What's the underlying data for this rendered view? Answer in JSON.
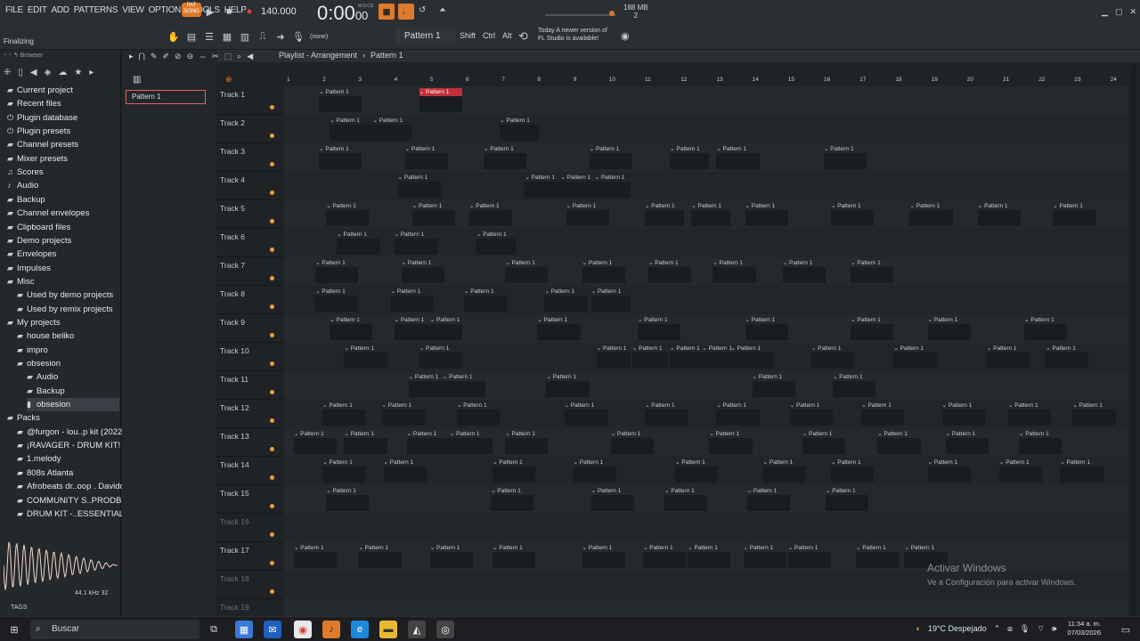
{
  "menu": [
    "FILE",
    "EDIT",
    "ADD",
    "PATTERNS",
    "VIEW",
    "OPTIONS",
    "TOOLS",
    "HELP"
  ],
  "transport": {
    "mode": "PAT SONG",
    "bpm": "140.000",
    "time_main": "0:00",
    "time_sub": "00",
    "time_unit": "M:S:CS"
  },
  "status": "Finalizing",
  "memory": {
    "label": "188 MB",
    "value": "2"
  },
  "toolbar": {
    "channel": "(none)",
    "pattern": "Pattern 1",
    "shift": "Shift",
    "ctrl": "Ctrl",
    "alt": "Alt"
  },
  "news": {
    "line1": "Today  A newer version of",
    "line2": "FL Studio is available!"
  },
  "browser": {
    "title": "Browser",
    "items": [
      {
        "label": "Current project",
        "icon": "folder-icon",
        "indent": 0
      },
      {
        "label": "Recent files",
        "icon": "folder-icon",
        "indent": 0
      },
      {
        "label": "Plugin database",
        "icon": "plug-icon",
        "indent": 0
      },
      {
        "label": "Plugin presets",
        "icon": "plug-icon",
        "indent": 0
      },
      {
        "label": "Channel presets",
        "icon": "folder-icon",
        "indent": 0
      },
      {
        "label": "Mixer presets",
        "icon": "folder-icon",
        "indent": 0
      },
      {
        "label": "Scores",
        "icon": "note-icon",
        "indent": 0
      },
      {
        "label": "Audio",
        "icon": "audio-icon",
        "indent": 0
      },
      {
        "label": "Backup",
        "icon": "folder-icon",
        "indent": 0
      },
      {
        "label": "Channel envelopes",
        "icon": "folder-icon",
        "indent": 0
      },
      {
        "label": "Clipboard files",
        "icon": "folder-icon",
        "indent": 0
      },
      {
        "label": "Demo projects",
        "icon": "folder-icon",
        "indent": 0
      },
      {
        "label": "Envelopes",
        "icon": "folder-icon",
        "indent": 0
      },
      {
        "label": "Impulses",
        "icon": "folder-icon",
        "indent": 0
      },
      {
        "label": "Misc",
        "icon": "folder-icon",
        "indent": 0
      },
      {
        "label": "Used by demo projects",
        "icon": "folder-icon",
        "indent": 1
      },
      {
        "label": "Used by remix projects",
        "icon": "folder-icon",
        "indent": 1
      },
      {
        "label": "My projects",
        "icon": "folder-icon",
        "indent": 0
      },
      {
        "label": "house beliko",
        "icon": "folder-icon",
        "indent": 1
      },
      {
        "label": "impro",
        "icon": "folder-icon",
        "indent": 1
      },
      {
        "label": "obsesion",
        "icon": "folder-icon",
        "indent": 1
      },
      {
        "label": "Audio",
        "icon": "folder-icon",
        "indent": 2
      },
      {
        "label": "Backup",
        "icon": "folder-icon",
        "indent": 2
      },
      {
        "label": "obsesion",
        "icon": "file-icon",
        "indent": 2,
        "selected": true
      },
      {
        "label": "Packs",
        "icon": "folder-icon",
        "indent": 0
      },
      {
        "label": "@furgon - lou..p kit (2022)",
        "icon": "pack-icon",
        "indent": 1
      },
      {
        "label": "¡RAVAGER - DRUM KIT!",
        "icon": "pack-icon",
        "indent": 1
      },
      {
        "label": "1.melody",
        "icon": "pack-icon",
        "indent": 1
      },
      {
        "label": "808s Atlanta",
        "icon": "pack-icon",
        "indent": 1
      },
      {
        "label": "Afrobeats dr..oop . Davido",
        "icon": "pack-icon",
        "indent": 1
      },
      {
        "label": "COMMUNITY S..PRODBYLJS",
        "icon": "pack-icon",
        "indent": 1
      },
      {
        "label": "DRUM KIT -..ESSENTIALS",
        "icon": "pack-icon",
        "indent": 1
      }
    ],
    "samplerate": "44.1 kHz 32",
    "tags": "TAGS"
  },
  "picker": {
    "pattern": "Pattern 1"
  },
  "playlist": {
    "title": "Playlist - Arrangement",
    "pattern": "Pattern 1",
    "ruler": [
      "1",
      "2",
      "3",
      "4",
      "5",
      "6",
      "7",
      "8",
      "9",
      "10",
      "11",
      "12",
      "13",
      "14",
      "15",
      "16",
      "17",
      "18",
      "19",
      "20",
      "21",
      "22",
      "23",
      "24"
    ],
    "clip_label": "Pattern 1",
    "tracks": [
      {
        "name": "Track 1",
        "clips": [
          [
            1.9,
            1.2
          ],
          [
            4.7,
            1.2,
            "red"
          ]
        ]
      },
      {
        "name": "Track 2",
        "clips": [
          [
            2.2,
            1.2
          ],
          [
            3.4,
            1.1
          ],
          [
            6.95,
            1.1
          ]
        ]
      },
      {
        "name": "Track 3",
        "clips": [
          [
            1.9,
            1.2
          ],
          [
            4.3,
            1.2
          ],
          [
            6.5,
            1.2
          ],
          [
            9.45,
            1.2
          ],
          [
            11.7,
            1.1
          ],
          [
            13.0,
            1.2
          ],
          [
            16.0,
            1.2
          ]
        ]
      },
      {
        "name": "Track 4",
        "clips": [
          [
            4.1,
            1.2
          ],
          [
            7.65,
            1.0
          ],
          [
            8.65,
            0.95
          ],
          [
            9.6,
            1.0
          ]
        ]
      },
      {
        "name": "Track 5",
        "clips": [
          [
            2.1,
            1.2
          ],
          [
            4.5,
            1.2
          ],
          [
            6.1,
            1.2
          ],
          [
            8.8,
            1.2
          ],
          [
            11.0,
            1.1
          ],
          [
            12.3,
            1.1
          ],
          [
            13.8,
            1.2
          ],
          [
            16.2,
            1.2
          ],
          [
            18.4,
            1.2
          ],
          [
            20.3,
            1.2
          ],
          [
            22.4,
            1.2
          ]
        ]
      },
      {
        "name": "Track 6",
        "clips": [
          [
            2.4,
            1.2
          ],
          [
            4.0,
            1.2
          ],
          [
            6.3,
            1.1
          ]
        ]
      },
      {
        "name": "Track 7",
        "clips": [
          [
            1.8,
            1.2
          ],
          [
            4.2,
            1.2
          ],
          [
            7.1,
            1.2
          ],
          [
            9.25,
            1.2
          ],
          [
            11.1,
            1.2
          ],
          [
            12.9,
            1.2
          ],
          [
            14.85,
            1.2
          ],
          [
            16.75,
            1.2
          ]
        ]
      },
      {
        "name": "Track 8",
        "clips": [
          [
            1.8,
            1.2
          ],
          [
            3.9,
            1.2
          ],
          [
            5.95,
            1.2
          ],
          [
            8.2,
            1.2
          ],
          [
            9.5,
            1.1
          ]
        ]
      },
      {
        "name": "Track 9",
        "clips": [
          [
            2.2,
            1.2
          ],
          [
            4.0,
            1.2
          ],
          [
            5.0,
            0.9
          ],
          [
            8.0,
            1.2
          ],
          [
            10.8,
            1.2
          ],
          [
            13.8,
            1.2
          ],
          [
            16.75,
            1.2
          ],
          [
            18.9,
            1.2
          ],
          [
            21.6,
            1.2
          ]
        ]
      },
      {
        "name": "Track 10",
        "clips": [
          [
            2.6,
            1.2
          ],
          [
            4.7,
            1.2
          ],
          [
            9.65,
            0.95
          ],
          [
            10.65,
            1.0
          ],
          [
            11.7,
            0.9
          ],
          [
            12.6,
            0.9
          ],
          [
            13.4,
            1.2
          ],
          [
            15.65,
            1.2
          ],
          [
            17.95,
            1.2
          ],
          [
            20.55,
            1.2
          ],
          [
            22.2,
            1.2
          ]
        ]
      },
      {
        "name": "Track 11",
        "clips": [
          [
            4.4,
            1.0
          ],
          [
            5.35,
            1.2
          ],
          [
            8.25,
            1.2
          ],
          [
            14.0,
            1.2
          ],
          [
            16.25,
            1.2
          ]
        ]
      },
      {
        "name": "Track 12",
        "clips": [
          [
            2.0,
            1.2
          ],
          [
            3.65,
            1.2
          ],
          [
            5.75,
            1.2
          ],
          [
            8.75,
            1.2
          ],
          [
            11.0,
            1.2
          ],
          [
            13.0,
            1.2
          ],
          [
            15.05,
            1.2
          ],
          [
            17.05,
            1.2
          ],
          [
            19.3,
            1.2
          ],
          [
            21.15,
            1.2
          ],
          [
            22.95,
            1.2
          ]
        ]
      },
      {
        "name": "Track 13",
        "clips": [
          [
            1.2,
            1.2
          ],
          [
            2.6,
            1.2
          ],
          [
            4.35,
            1.2
          ],
          [
            5.55,
            1.2
          ],
          [
            7.1,
            1.2
          ],
          [
            10.05,
            1.2
          ],
          [
            12.8,
            1.2
          ],
          [
            15.4,
            1.2
          ],
          [
            17.5,
            1.2
          ],
          [
            19.4,
            1.2
          ],
          [
            21.45,
            1.2
          ]
        ]
      },
      {
        "name": "Track 14",
        "clips": [
          [
            2.0,
            1.2
          ],
          [
            3.7,
            1.2
          ],
          [
            6.75,
            1.2
          ],
          [
            9.0,
            1.2
          ],
          [
            11.85,
            1.2
          ],
          [
            14.3,
            1.2
          ],
          [
            16.2,
            1.2
          ],
          [
            18.9,
            1.2
          ],
          [
            20.9,
            1.2
          ],
          [
            22.6,
            1.2
          ]
        ]
      },
      {
        "name": "Track 15",
        "clips": [
          [
            2.1,
            1.2
          ],
          [
            6.7,
            1.2
          ],
          [
            9.5,
            1.2
          ],
          [
            11.55,
            1.2
          ],
          [
            13.85,
            1.2
          ],
          [
            16.05,
            1.2
          ]
        ]
      },
      {
        "name": "Track 16",
        "dim": true,
        "clips": []
      },
      {
        "name": "Track 17",
        "clips": [
          [
            1.2,
            1.2
          ],
          [
            3.0,
            1.2
          ],
          [
            5.0,
            1.2
          ],
          [
            6.75,
            1.2
          ],
          [
            9.25,
            1.2
          ],
          [
            10.95,
            1.2
          ],
          [
            12.2,
            1.2
          ],
          [
            13.75,
            1.2
          ],
          [
            15.0,
            1.2
          ],
          [
            16.9,
            1.2
          ],
          [
            18.25,
            1.2
          ]
        ]
      },
      {
        "name": "Track 18",
        "dim": true,
        "clips": []
      },
      {
        "name": "Track 19",
        "dim": true,
        "clips": []
      }
    ]
  },
  "watermark": {
    "title": "Activar Windows",
    "sub": "Ve a Configuración para activar Windows."
  },
  "taskbar": {
    "search": "Buscar",
    "weather": "19°C  Despejado",
    "time": "11:34 a. m.",
    "date": "07/03/2026"
  }
}
